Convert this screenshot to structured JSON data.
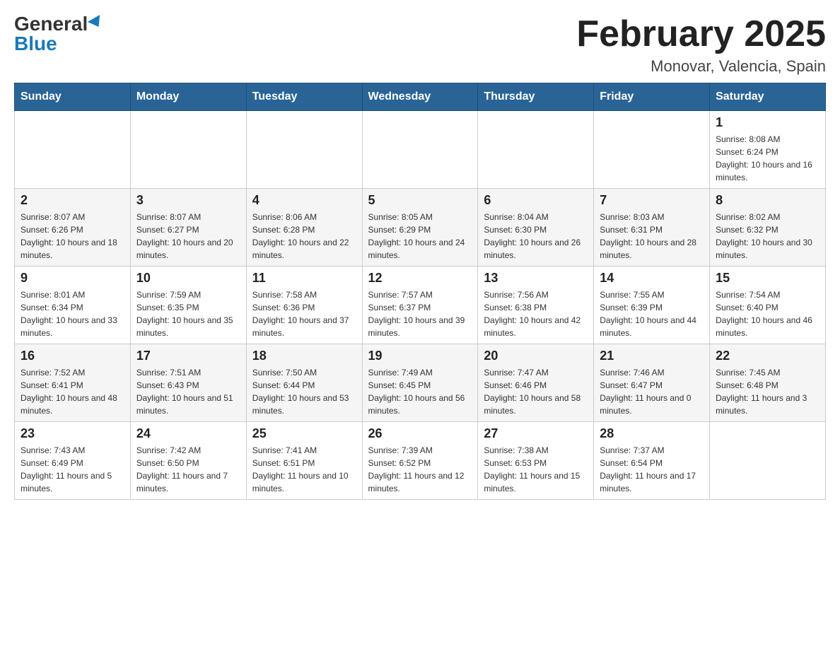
{
  "header": {
    "logo_general": "General",
    "logo_blue": "Blue",
    "month_title": "February 2025",
    "location": "Monovar, Valencia, Spain"
  },
  "days_of_week": [
    "Sunday",
    "Monday",
    "Tuesday",
    "Wednesday",
    "Thursday",
    "Friday",
    "Saturday"
  ],
  "weeks": [
    {
      "days": [
        {
          "num": "",
          "info": ""
        },
        {
          "num": "",
          "info": ""
        },
        {
          "num": "",
          "info": ""
        },
        {
          "num": "",
          "info": ""
        },
        {
          "num": "",
          "info": ""
        },
        {
          "num": "",
          "info": ""
        },
        {
          "num": "1",
          "info": "Sunrise: 8:08 AM\nSunset: 6:24 PM\nDaylight: 10 hours and 16 minutes."
        }
      ]
    },
    {
      "days": [
        {
          "num": "2",
          "info": "Sunrise: 8:07 AM\nSunset: 6:26 PM\nDaylight: 10 hours and 18 minutes."
        },
        {
          "num": "3",
          "info": "Sunrise: 8:07 AM\nSunset: 6:27 PM\nDaylight: 10 hours and 20 minutes."
        },
        {
          "num": "4",
          "info": "Sunrise: 8:06 AM\nSunset: 6:28 PM\nDaylight: 10 hours and 22 minutes."
        },
        {
          "num": "5",
          "info": "Sunrise: 8:05 AM\nSunset: 6:29 PM\nDaylight: 10 hours and 24 minutes."
        },
        {
          "num": "6",
          "info": "Sunrise: 8:04 AM\nSunset: 6:30 PM\nDaylight: 10 hours and 26 minutes."
        },
        {
          "num": "7",
          "info": "Sunrise: 8:03 AM\nSunset: 6:31 PM\nDaylight: 10 hours and 28 minutes."
        },
        {
          "num": "8",
          "info": "Sunrise: 8:02 AM\nSunset: 6:32 PM\nDaylight: 10 hours and 30 minutes."
        }
      ]
    },
    {
      "days": [
        {
          "num": "9",
          "info": "Sunrise: 8:01 AM\nSunset: 6:34 PM\nDaylight: 10 hours and 33 minutes."
        },
        {
          "num": "10",
          "info": "Sunrise: 7:59 AM\nSunset: 6:35 PM\nDaylight: 10 hours and 35 minutes."
        },
        {
          "num": "11",
          "info": "Sunrise: 7:58 AM\nSunset: 6:36 PM\nDaylight: 10 hours and 37 minutes."
        },
        {
          "num": "12",
          "info": "Sunrise: 7:57 AM\nSunset: 6:37 PM\nDaylight: 10 hours and 39 minutes."
        },
        {
          "num": "13",
          "info": "Sunrise: 7:56 AM\nSunset: 6:38 PM\nDaylight: 10 hours and 42 minutes."
        },
        {
          "num": "14",
          "info": "Sunrise: 7:55 AM\nSunset: 6:39 PM\nDaylight: 10 hours and 44 minutes."
        },
        {
          "num": "15",
          "info": "Sunrise: 7:54 AM\nSunset: 6:40 PM\nDaylight: 10 hours and 46 minutes."
        }
      ]
    },
    {
      "days": [
        {
          "num": "16",
          "info": "Sunrise: 7:52 AM\nSunset: 6:41 PM\nDaylight: 10 hours and 48 minutes."
        },
        {
          "num": "17",
          "info": "Sunrise: 7:51 AM\nSunset: 6:43 PM\nDaylight: 10 hours and 51 minutes."
        },
        {
          "num": "18",
          "info": "Sunrise: 7:50 AM\nSunset: 6:44 PM\nDaylight: 10 hours and 53 minutes."
        },
        {
          "num": "19",
          "info": "Sunrise: 7:49 AM\nSunset: 6:45 PM\nDaylight: 10 hours and 56 minutes."
        },
        {
          "num": "20",
          "info": "Sunrise: 7:47 AM\nSunset: 6:46 PM\nDaylight: 10 hours and 58 minutes."
        },
        {
          "num": "21",
          "info": "Sunrise: 7:46 AM\nSunset: 6:47 PM\nDaylight: 11 hours and 0 minutes."
        },
        {
          "num": "22",
          "info": "Sunrise: 7:45 AM\nSunset: 6:48 PM\nDaylight: 11 hours and 3 minutes."
        }
      ]
    },
    {
      "days": [
        {
          "num": "23",
          "info": "Sunrise: 7:43 AM\nSunset: 6:49 PM\nDaylight: 11 hours and 5 minutes."
        },
        {
          "num": "24",
          "info": "Sunrise: 7:42 AM\nSunset: 6:50 PM\nDaylight: 11 hours and 7 minutes."
        },
        {
          "num": "25",
          "info": "Sunrise: 7:41 AM\nSunset: 6:51 PM\nDaylight: 11 hours and 10 minutes."
        },
        {
          "num": "26",
          "info": "Sunrise: 7:39 AM\nSunset: 6:52 PM\nDaylight: 11 hours and 12 minutes."
        },
        {
          "num": "27",
          "info": "Sunrise: 7:38 AM\nSunset: 6:53 PM\nDaylight: 11 hours and 15 minutes."
        },
        {
          "num": "28",
          "info": "Sunrise: 7:37 AM\nSunset: 6:54 PM\nDaylight: 11 hours and 17 minutes."
        },
        {
          "num": "",
          "info": ""
        }
      ]
    }
  ]
}
